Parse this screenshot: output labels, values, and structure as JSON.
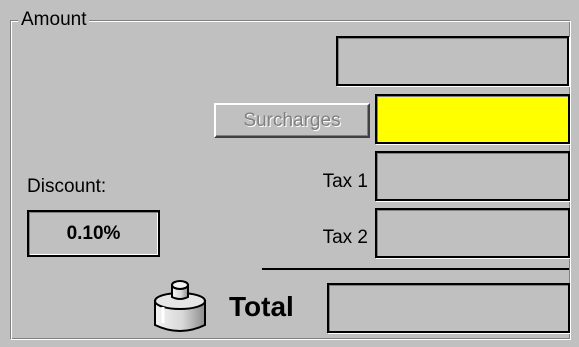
{
  "amount_group": {
    "title": "Amount",
    "amount_value": "",
    "surcharges_button_label": "Surcharges",
    "surcharges_value": "",
    "tax1_label": "Tax 1",
    "tax1_value": "",
    "tax2_label": "Tax 2",
    "tax2_value": "",
    "discount_label": "Discount:",
    "discount_value": "0.10%",
    "total_label": "Total",
    "total_value": "",
    "total_icon": "weight-icon"
  },
  "colors": {
    "background": "#c0c0c0",
    "surcharges_field": "#ffff00",
    "disabled_text": "#808080"
  }
}
